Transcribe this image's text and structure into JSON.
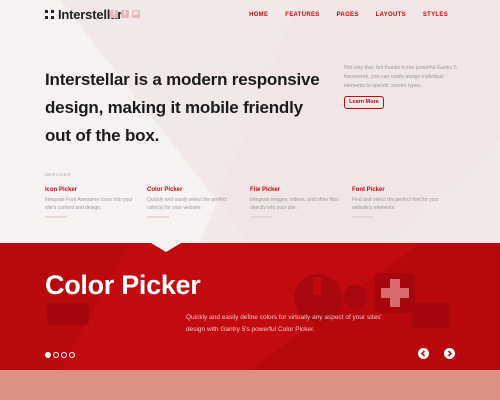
{
  "header": {
    "logo_text": "Interstellar",
    "social": [
      "f",
      "t",
      "in"
    ],
    "nav": [
      "HOME",
      "FEATURES",
      "PAGES",
      "LAYOUTS",
      "STYLES"
    ]
  },
  "hero": {
    "headline": "Interstellar is a modern responsive design, making it mobile friendly out of the box.",
    "side_text": "Not only that, but thanks to the powerful Gantry 5 framework, you can easily assign individual elements to specific screen types.",
    "button_label": "Learn More"
  },
  "services": {
    "label": "SERVICES",
    "items": [
      {
        "title": "Icon Picker",
        "text": "Integrate Font Awesome icons into your site's content and design."
      },
      {
        "title": "Color Picker",
        "text": "Quickly and easily select the perfect color(s) for your website."
      },
      {
        "title": "File Picker",
        "text": "Integrate images, videos, and other files directly into your site."
      },
      {
        "title": "Font Picker",
        "text": "Find and select the perfect font for your website's elements."
      }
    ]
  },
  "slider": {
    "title": "Color Picker",
    "text": "Quickly and easily define colors for virtually any aspect of your sites' design with Gantry 5's powerful Color Picker.",
    "dots_count": 4,
    "active_dot": 1
  },
  "colors": {
    "accent": "#c40a10",
    "slider_bg": "#c20a10",
    "bottom_band": "#dc8f83"
  }
}
